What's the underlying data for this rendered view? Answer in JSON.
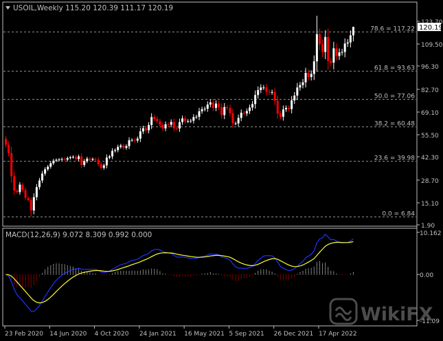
{
  "colors": {
    "background": "#000000",
    "frame": "#c0c0c0",
    "text": "#c0c0c0",
    "bull": "#ffffff",
    "bear": "#ff0000",
    "fib_line": "#c0c0c0",
    "macd_line": "#1f32ff",
    "signal_line": "#ffff33",
    "hist_pos": "#ffffff",
    "hist_neg": "#ff0000",
    "price_box_bg": "#ffffff",
    "price_box_text": "#000000"
  },
  "chart_data": [
    {
      "type": "candlestick",
      "symbol": "USOIL",
      "timeframe": "Weekly",
      "header_text": "USOIL,Weekly  115.20 120.39 111.17 120.19",
      "ohlc": {
        "open": 115.2,
        "high": 120.39,
        "low": 111.17,
        "close": 120.19
      },
      "current_price": "120.19",
      "ylim": [
        1.9,
        125.0
      ],
      "y_ticks": [
        "123.70",
        "109.50",
        "96.30",
        "82.70",
        "69.10",
        "55.50",
        "42.30",
        "28.70",
        "15.10",
        "1.90"
      ],
      "y_tick_values": [
        123.7,
        109.5,
        96.3,
        82.7,
        69.1,
        55.5,
        42.3,
        28.7,
        15.1,
        1.9
      ],
      "x_ticks": [
        "23 Feb 2020",
        "14 Jun 2020",
        "4 Oct 2020",
        "24 Jan 2021",
        "16 May 2021",
        "5 Sep 2021",
        "26 Dec 2021",
        "17 Apr 2022"
      ],
      "x_tick_weeks": [
        0,
        16,
        32,
        48,
        64,
        80,
        96,
        112
      ],
      "fibonacci": [
        {
          "label": "78.6 = 117.22",
          "value": 117.22
        },
        {
          "label": "61.8 = 93.63",
          "value": 93.63
        },
        {
          "label": "50.0 = 77.06",
          "value": 77.06
        },
        {
          "label": "38.2 = 60.48",
          "value": 60.48
        },
        {
          "label": "23.6 = 39.98",
          "value": 39.98
        },
        {
          "label": "0.0 = 6.84",
          "value": 6.84
        }
      ],
      "closes": [
        49.5,
        44.5,
        31.0,
        22.4,
        21.5,
        26.0,
        22.8,
        18.0,
        16.8,
        10.5,
        18.5,
        24.5,
        28.5,
        32.5,
        35.0,
        36.5,
        38.5,
        40.0,
        40.5,
        40.7,
        41.0,
        40.6,
        41.5,
        42.0,
        42.3,
        41.0,
        42.5,
        37.5,
        39.7,
        41.2,
        40.5,
        41.0,
        40.6,
        38.0,
        35.8,
        37.3,
        41.8,
        42.5,
        45.8,
        46.3,
        48.2,
        49.0,
        47.6,
        48.7,
        52.2,
        52.4,
        52.0,
        53.2,
        57.5,
        59.4,
        58.2,
        61.3,
        66.1,
        65.0,
        63.5,
        61.5,
        59.3,
        61.8,
        61.5,
        63.2,
        59.4,
        59.3,
        63.1,
        65.3,
        63.6,
        63.7,
        63.9,
        66.1,
        66.3,
        69.6,
        70.8,
        71.1,
        73.6,
        74.9,
        71.6,
        74.2,
        72.0,
        67.3,
        72.1,
        71.6,
        68.4,
        62.3,
        62.3,
        65.6,
        68.7,
        68.3,
        69.7,
        71.8,
        73.9,
        79.3,
        82.3,
        83.8,
        83.8,
        81.3,
        80.9,
        81.1,
        75.9,
        68.2,
        66.3,
        70.7,
        71.6,
        70.9,
        76.1,
        79.0,
        83.8,
        85.2,
        86.8,
        92.3,
        89.9,
        91.7,
        99.1,
        115.7,
        109.3,
        104.7,
        113.9,
        99.3,
        98.3,
        106.9,
        102.3,
        104.5,
        104.7,
        109.8,
        110.5,
        114.9,
        120.19
      ]
    },
    {
      "type": "macd",
      "header_text": "MACD(12,26,9) 9.072 8.309 0.992 0.000",
      "params": "12,26,9",
      "values": {
        "macd": 9.072,
        "signal": 8.309,
        "histogram": 0.992,
        "extra": 0.0
      },
      "ylim": [
        -11.09,
        10.162
      ],
      "y_ticks": [
        "10.162",
        "0.00",
        "-11.09"
      ],
      "y_tick_values": [
        10.162,
        0.0,
        -11.09
      ]
    }
  ]
}
